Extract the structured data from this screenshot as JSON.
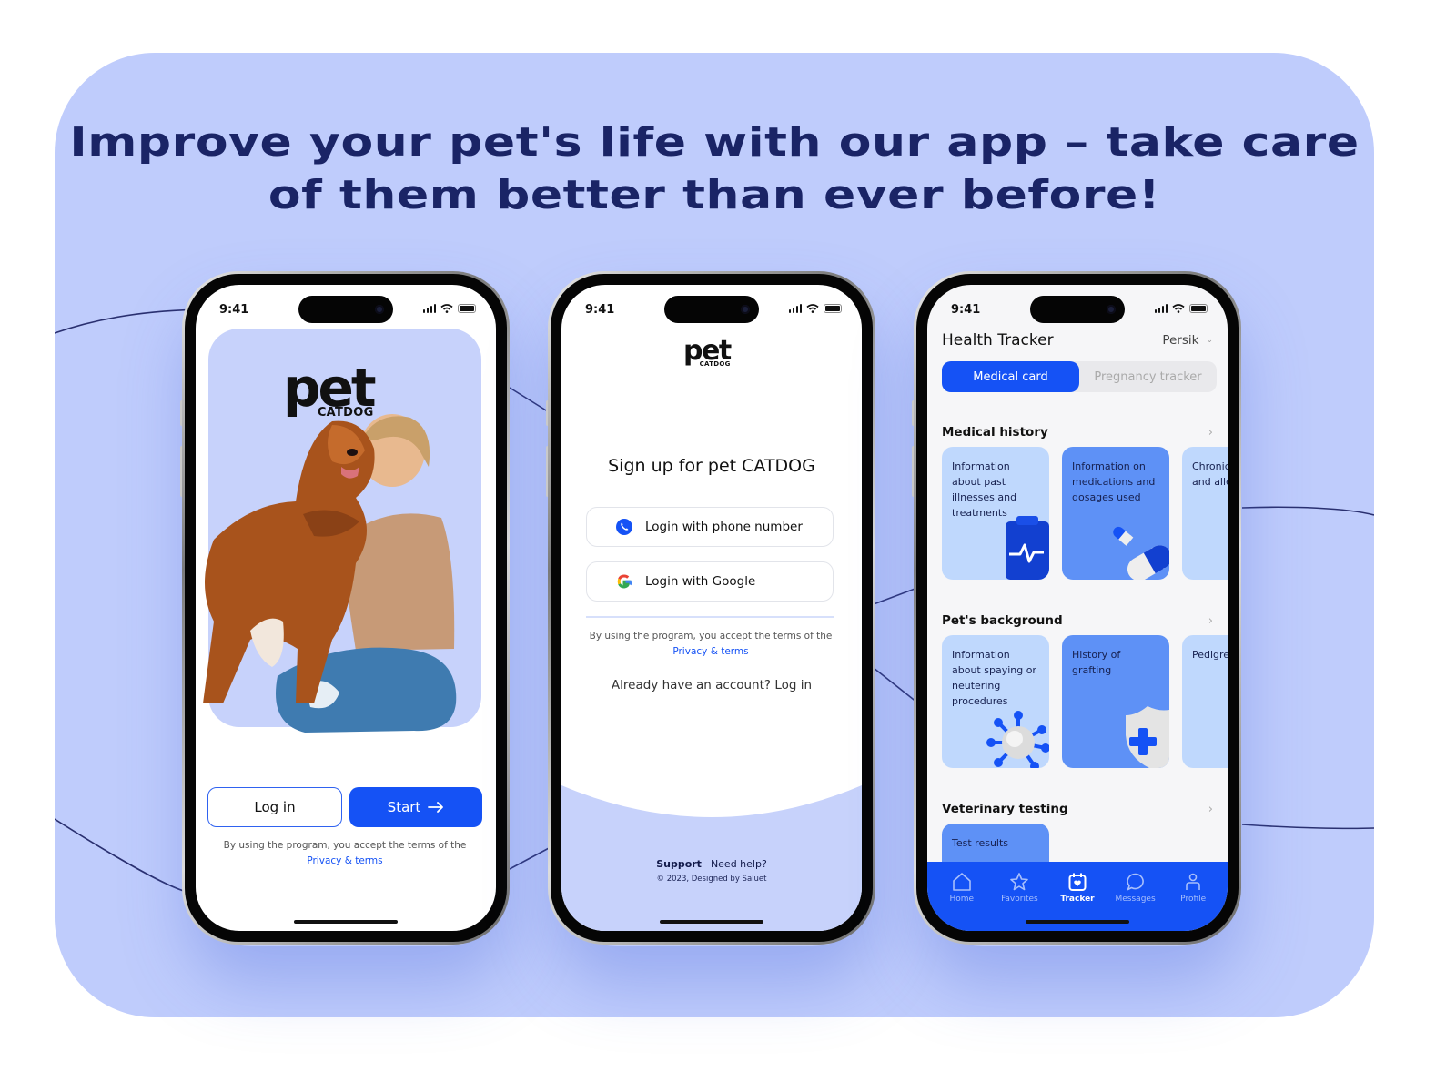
{
  "headline": {
    "line1": "Improve your pet's life with our app – take care",
    "line2": "of them better than ever before!"
  },
  "colors": {
    "background": "#bfccfc",
    "headline": "#1a2466",
    "primary": "#1552f5",
    "card_light": "#bfd8fd",
    "card_mid": "#5e91f6"
  },
  "status_bar": {
    "time": "9:41"
  },
  "brand": {
    "name": "pet",
    "sub": "CATDOG"
  },
  "welcome_screen": {
    "login_button": "Log in",
    "start_button": "Start",
    "start_icon": "arrow-right-icon",
    "terms_text": "By using the program, you accept the terms of the",
    "terms_link": "Privacy & terms"
  },
  "signup_screen": {
    "title": "Sign up for pet CATDOG",
    "options": [
      {
        "label": "Login with phone number",
        "icon": "phone-icon"
      },
      {
        "label": "Login with Google",
        "icon": "google-icon"
      }
    ],
    "terms_text": "By using the program, you accept the terms of the",
    "terms_link": "Privacy & terms",
    "already_account": "Already have an account? Log in",
    "footer_support": "Support",
    "footer_help": "Need help?",
    "copyright": "© 2023, Designed by Saluet"
  },
  "tracker_screen": {
    "title": "Health Tracker",
    "pet_selector": "Persik",
    "segments": [
      {
        "label": "Medical card",
        "active": true
      },
      {
        "label": "Pregnancy tracker",
        "active": false
      }
    ],
    "sections": [
      {
        "title": "Medical history",
        "cards": [
          {
            "text": "Information about past illnesses and treatments",
            "icon": "clipboard-pulse-icon"
          },
          {
            "text": "Information on medications and dosages used",
            "icon": "pills-icon"
          },
          {
            "text": "Chronic diseases and allergies",
            "icon": ""
          }
        ]
      },
      {
        "title": "Pet's background",
        "cards": [
          {
            "text": "Information about spaying or neutering procedures",
            "icon": "virus-icon"
          },
          {
            "text": "History of grafting",
            "icon": "shield-plus-icon"
          },
          {
            "text": "Pedigree",
            "icon": ""
          }
        ]
      },
      {
        "title": "Veterinary testing",
        "cards": [
          {
            "text": "Test results",
            "icon": ""
          }
        ]
      }
    ],
    "tabs": [
      {
        "label": "Home",
        "icon": "home-icon",
        "active": false
      },
      {
        "label": "Favorites",
        "icon": "star-icon",
        "active": false
      },
      {
        "label": "Tracker",
        "icon": "calendar-heart-icon",
        "active": true
      },
      {
        "label": "Messages",
        "icon": "chat-bubble-icon",
        "active": false
      },
      {
        "label": "Profile",
        "icon": "person-icon",
        "active": false
      }
    ]
  }
}
